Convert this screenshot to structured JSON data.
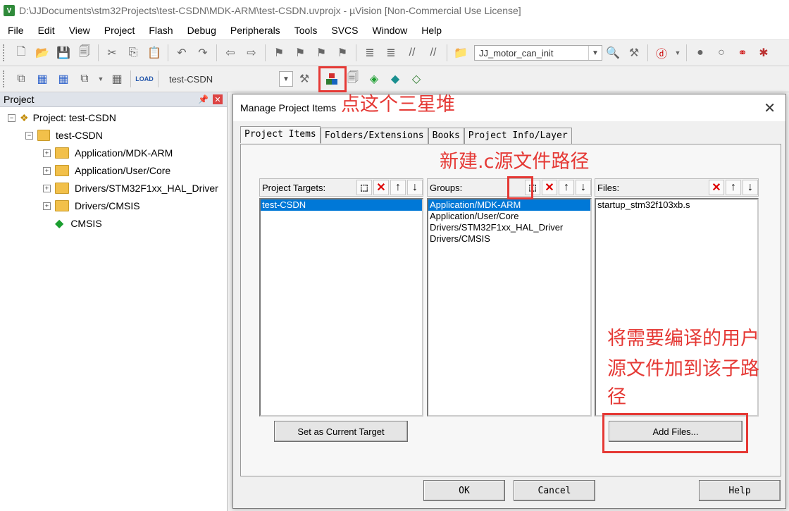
{
  "window": {
    "title": "D:\\JJDocuments\\stm32Projects\\test-CSDN\\MDK-ARM\\test-CSDN.uvprojx - µVision  [Non-Commercial Use License]"
  },
  "menu": [
    "File",
    "Edit",
    "View",
    "Project",
    "Flash",
    "Debug",
    "Peripherals",
    "Tools",
    "SVCS",
    "Window",
    "Help"
  ],
  "toolbar": {
    "function_combo": "JJ_motor_can_init",
    "target_combo": "test-CSDN"
  },
  "project_panel": {
    "title": "Project",
    "root": "Project: test-CSDN",
    "target": "test-CSDN",
    "groups": [
      "Application/MDK-ARM",
      "Application/User/Core",
      "Drivers/STM32F1xx_HAL_Driver",
      "Drivers/CMSIS"
    ],
    "cmsis": "CMSIS"
  },
  "dialog": {
    "title": "Manage Project Items",
    "tabs": [
      "Project Items",
      "Folders/Extensions",
      "Books",
      "Project Info/Layer"
    ],
    "targets_label": "Project Targets:",
    "targets": [
      "test-CSDN"
    ],
    "groups_label": "Groups:",
    "groups": [
      "Application/MDK-ARM",
      "Application/User/Core",
      "Drivers/STM32F1xx_HAL_Driver",
      "Drivers/CMSIS"
    ],
    "files_label": "Files:",
    "files": [
      "startup_stm32f103xb.s"
    ],
    "set_current_label": "Set as Current Target",
    "add_files_label": "Add Files...",
    "ok_label": "OK",
    "cancel_label": "Cancel",
    "help_label": "Help"
  },
  "annotations": {
    "a1": "点这个三星堆",
    "a2": "新建.c源文件路径",
    "a3_line1": "将需要编译的用户",
    "a3_line2": "源文件加到该子路",
    "a3_line3": "径"
  },
  "colors": {
    "annotation": "#e53935",
    "selection": "#0078d7"
  }
}
